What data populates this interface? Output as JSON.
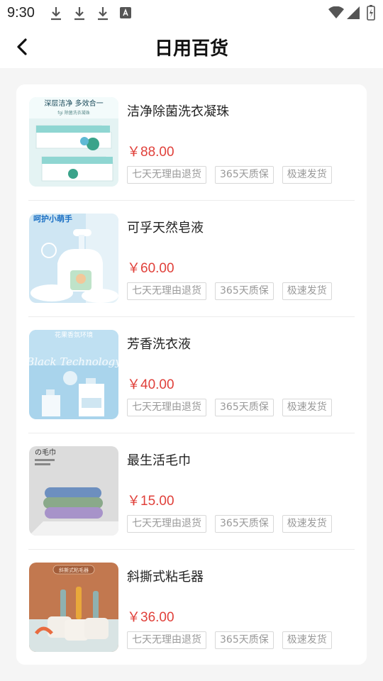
{
  "status": {
    "time": "9:30"
  },
  "header": {
    "title": "日用百货"
  },
  "tags": [
    "七天无理由退货",
    "365天质保",
    "极速发货"
  ],
  "products": [
    {
      "name": "洁净除菌洗衣凝珠",
      "price": "￥88.00",
      "image_text": "深层洁净 多效合一",
      "image_subtext": "fgi 除菌洗衣凝珠"
    },
    {
      "name": "可孚天然皂液",
      "price": "￥60.00",
      "image_text": "呵护小萌手",
      "image_subtext": ""
    },
    {
      "name": "芳香洗衣液",
      "price": "￥40.00",
      "image_text": "花果香氛环境",
      "image_subtext": "Black Technology"
    },
    {
      "name": "最生活毛巾",
      "price": "￥15.00",
      "image_text": "の毛巾",
      "image_subtext": ""
    },
    {
      "name": "斜撕式粘毛器",
      "price": "￥36.00",
      "image_text": "斜撕式粘毛器",
      "image_subtext": ""
    }
  ],
  "colors": {
    "price": "#e0403a",
    "accent": "#111111"
  }
}
